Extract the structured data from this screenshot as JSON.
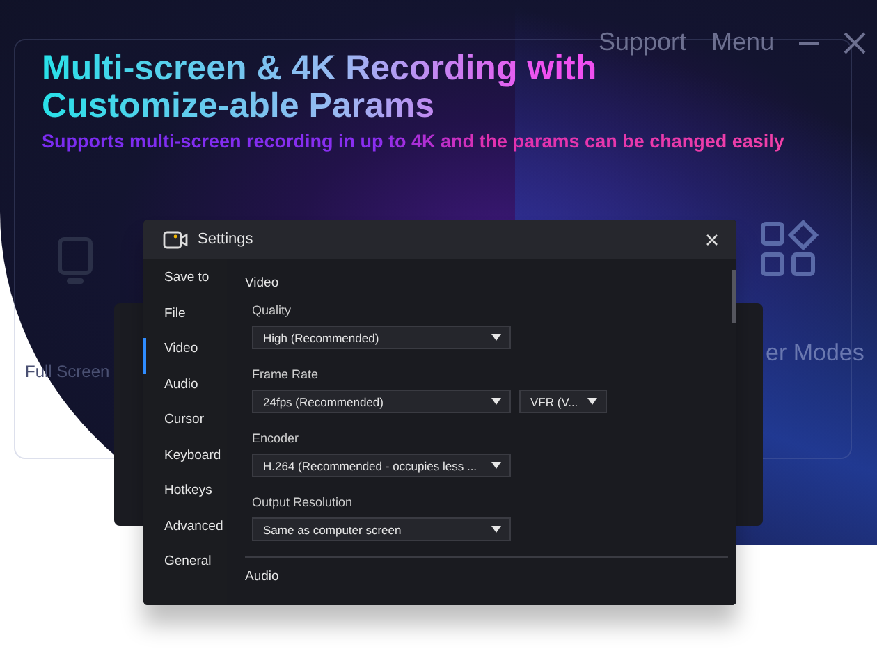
{
  "background_app": {
    "menu_items": [
      "Support",
      "Menu"
    ],
    "modes": [
      {
        "label": "Full Screen"
      },
      {
        "label": "er Modes"
      }
    ]
  },
  "headline": "Multi-screen & 4K Recording with Customize-able Params",
  "subtitle": "Supports multi-screen recording in up to 4K and the params can be changed easily",
  "dialog": {
    "title": "Settings",
    "nav": [
      {
        "label": "Save to",
        "selected": false
      },
      {
        "label": "File",
        "selected": false
      },
      {
        "label": "Video",
        "selected": true
      },
      {
        "label": "Audio",
        "selected": false
      },
      {
        "label": "Cursor",
        "selected": false
      },
      {
        "label": "Keyboard",
        "selected": false
      },
      {
        "label": "Hotkeys",
        "selected": false
      },
      {
        "label": "Advanced",
        "selected": false
      },
      {
        "label": "General",
        "selected": false
      }
    ],
    "section": "Video",
    "fields": [
      {
        "label": "Quality",
        "dropdowns": [
          "High (Recommended)"
        ]
      },
      {
        "label": "Frame Rate",
        "dropdowns": [
          "24fps (Recommended)",
          "VFR (V..."
        ]
      },
      {
        "label": "Encoder",
        "dropdowns": [
          "H.264 (Recommended - occupies less ..."
        ]
      },
      {
        "label": "Output Resolution",
        "dropdowns": [
          "Same as computer screen"
        ]
      }
    ],
    "next_section": "Audio"
  }
}
